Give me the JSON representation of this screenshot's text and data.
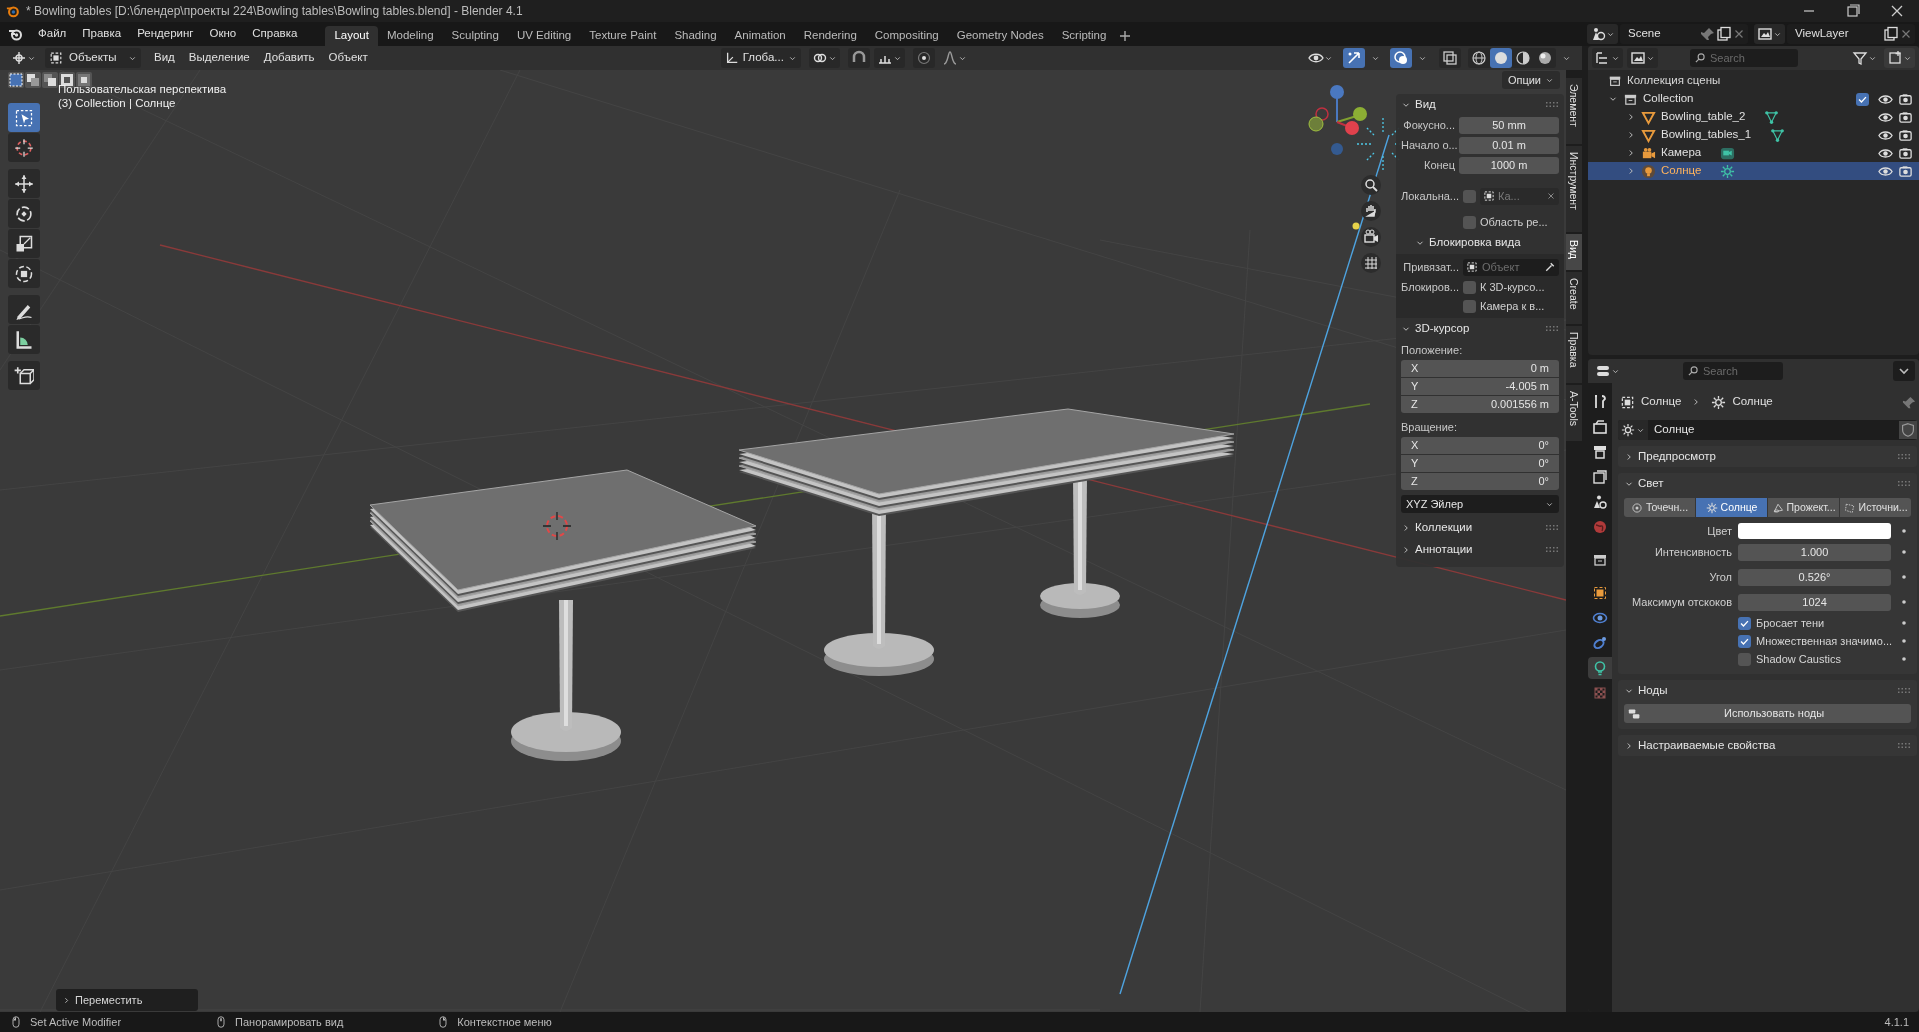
{
  "window": {
    "title": "* Bowling tables [D:\\блендер\\проекты 224\\Bowling tables\\Bowling tables.blend] - Blender 4.1"
  },
  "menu": [
    "Файл",
    "Правка",
    "Рендеринг",
    "Окно",
    "Справка"
  ],
  "workspaces": [
    {
      "label": "Layout",
      "selected": true
    },
    {
      "label": "Modeling",
      "selected": false
    },
    {
      "label": "Sculpting",
      "selected": false
    },
    {
      "label": "UV Editing",
      "selected": false
    },
    {
      "label": "Texture Paint",
      "selected": false
    },
    {
      "label": "Shading",
      "selected": false
    },
    {
      "label": "Animation",
      "selected": false
    },
    {
      "label": "Rendering",
      "selected": false
    },
    {
      "label": "Compositing",
      "selected": false
    },
    {
      "label": "Geometry Nodes",
      "selected": false
    },
    {
      "label": "Scripting",
      "selected": false
    }
  ],
  "scene": "Scene",
  "view_layer": "ViewLayer",
  "viewport": {
    "mode": "Объекты",
    "menus": [
      "Вид",
      "Выделение",
      "Добавить",
      "Объект"
    ],
    "orientation": "Глоба...",
    "options": "Опции",
    "shading": [
      {
        "kind": "wireframe",
        "selected": false
      },
      {
        "kind": "solid",
        "selected": true
      },
      {
        "kind": "material",
        "selected": false
      },
      {
        "kind": "rendered",
        "selected": false
      }
    ],
    "view_name": "Пользовательская перспектива",
    "context": "(3) Collection | Солнце",
    "tools": [
      {
        "kind": "select",
        "selected": true
      },
      {
        "kind": "cursor",
        "selected": false
      },
      {
        "kind": "move",
        "selected": false
      },
      {
        "kind": "rotate",
        "selected": false
      },
      {
        "kind": "scale",
        "selected": false
      },
      {
        "kind": "transform",
        "selected": false
      },
      {
        "kind": "annotate",
        "selected": false
      },
      {
        "kind": "measure",
        "selected": false
      },
      {
        "kind": "add_cube",
        "selected": false
      }
    ],
    "last_operator": "Переместить"
  },
  "sidebar": {
    "tabs": [
      {
        "label": "Элемент",
        "selected": false
      },
      {
        "label": "Инструмент",
        "selected": false
      },
      {
        "label": "Вид",
        "selected": true
      },
      {
        "label": "Create",
        "selected": false
      },
      {
        "label": "Правка",
        "selected": false
      },
      {
        "label": "A-Tools",
        "selected": false
      }
    ],
    "view_panel": {
      "title": "Вид",
      "fields": [
        {
          "label": "Фокусно...",
          "value": "50 mm"
        },
        {
          "label": "Начало о...",
          "value": "0.01 m"
        },
        {
          "label": "Конец",
          "value": "1000 m"
        }
      ],
      "local_camera": {
        "label": "Локальна...",
        "checked": false,
        "value": "Ка..."
      },
      "region": {
        "label": "Область ре...",
        "checked": false
      },
      "lock": {
        "title": "Блокировка вида",
        "object_label": "Привязат...",
        "object_placeholder": "Объект",
        "lock_label": "Блокиров...",
        "checks": [
          {
            "label": "К 3D-курсо...",
            "checked": false
          },
          {
            "label": "Камера к в...",
            "checked": false
          }
        ]
      }
    },
    "cursor_panel": {
      "title": "3D-курсор",
      "location_label": "Положение:",
      "location": [
        {
          "axis": "X",
          "value": "0 m"
        },
        {
          "axis": "Y",
          "value": "-4.005 m"
        },
        {
          "axis": "Z",
          "value": "0.001556 m"
        }
      ],
      "rotation_label": "Вращение:",
      "rotation": [
        {
          "axis": "X",
          "value": "0°"
        },
        {
          "axis": "Y",
          "value": "0°"
        },
        {
          "axis": "Z",
          "value": "0°"
        }
      ],
      "mode": "XYZ Эйлер"
    },
    "collapsed_panels": [
      "Коллекции",
      "Аннотации"
    ]
  },
  "outliner": {
    "search_placeholder": "Search",
    "root": "Коллекция сцены",
    "items": [
      {
        "name": "Collection",
        "kind": "collection",
        "expanded": true,
        "checked": true,
        "selected": false,
        "children": [
          {
            "name": "Bowling_table_2",
            "kind": "mesh",
            "expanded": false,
            "selected": false
          },
          {
            "name": "Bowling_tables_1",
            "kind": "mesh",
            "expanded": false,
            "selected": false
          },
          {
            "name": "Камера",
            "kind": "camera",
            "expanded": false,
            "selected": false
          },
          {
            "name": "Солнце",
            "kind": "light",
            "expanded": false,
            "selected": true
          }
        ]
      }
    ]
  },
  "properties": {
    "search_placeholder": "Search",
    "breadcrumb": [
      "Солнце",
      "Солнце"
    ],
    "datablock": "Солнце",
    "tabs": [
      {
        "kind": "tool",
        "selected": false
      },
      {
        "kind": "render",
        "selected": false
      },
      {
        "kind": "output",
        "selected": false
      },
      {
        "kind": "view_layer",
        "selected": false
      },
      {
        "kind": "scene",
        "selected": false
      },
      {
        "kind": "world",
        "selected": false
      },
      {
        "kind": "collection",
        "selected": false
      },
      {
        "kind": "object",
        "selected": false
      },
      {
        "kind": "physics",
        "selected": false
      },
      {
        "kind": "constraints",
        "selected": false
      },
      {
        "kind": "data",
        "selected": true
      },
      {
        "kind": "texture",
        "selected": false
      }
    ],
    "preview_title": "Предпросмотр",
    "light_title": "Свет",
    "light_types": [
      {
        "kind": "point",
        "label": "Точечн...",
        "selected": false
      },
      {
        "kind": "sun",
        "label": "Солнце",
        "selected": true
      },
      {
        "kind": "spot",
        "label": "Прожект...",
        "selected": false
      },
      {
        "kind": "area",
        "label": "Источни...",
        "selected": false
      }
    ],
    "color": {
      "label": "Цвет",
      "color": "#ffffff"
    },
    "fields": [
      {
        "label": "Интенсивность",
        "value": "1.000"
      },
      {
        "label": "Угол",
        "value": "0.526°"
      },
      {
        "label": "Максимум отскоков",
        "value": "1024"
      }
    ],
    "checks": [
      {
        "label": "Бросает тени",
        "checked": true
      },
      {
        "label": "Множественная значимо...",
        "checked": true
      },
      {
        "label": "Shadow Caustics",
        "checked": false
      }
    ],
    "nodes_title": "Ноды",
    "nodes_button": "Использовать ноды",
    "custom_title": "Настраиваемые свойства"
  },
  "status_bar": {
    "items": [
      "Set Active Modifier",
      "Панорамировать вид",
      "Контекстное меню"
    ],
    "version": "4.1.1"
  }
}
